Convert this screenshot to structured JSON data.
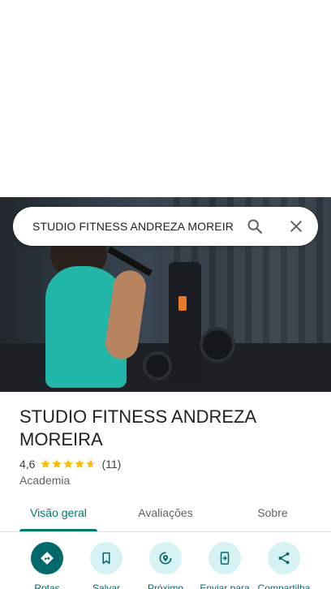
{
  "search": {
    "query": "STUDIO FITNESS ANDREZA MOREIR"
  },
  "place": {
    "name": "STUDIO FITNESS ANDREZA MOREIRA",
    "rating": "4,6",
    "stars": 4.6,
    "review_count": "(11)",
    "category": "Academia"
  },
  "tabs": [
    {
      "label": "Visão geral",
      "active": true
    },
    {
      "label": "Avaliações",
      "active": false
    },
    {
      "label": "Sobre",
      "active": false
    }
  ],
  "actions": [
    {
      "label": "Rotas",
      "icon": "directions-icon"
    },
    {
      "label": "Salvar",
      "icon": "bookmark-icon"
    },
    {
      "label": "Próximo",
      "icon": "nearby-icon"
    },
    {
      "label": "Enviar para",
      "icon": "send-to-phone-icon"
    },
    {
      "label": "Compartilha",
      "icon": "share-icon"
    }
  ],
  "colors": {
    "accent": "#00796b",
    "action_primary": "#00696b",
    "action_bg": "#d7f2f5",
    "star": "#fbbc04"
  }
}
